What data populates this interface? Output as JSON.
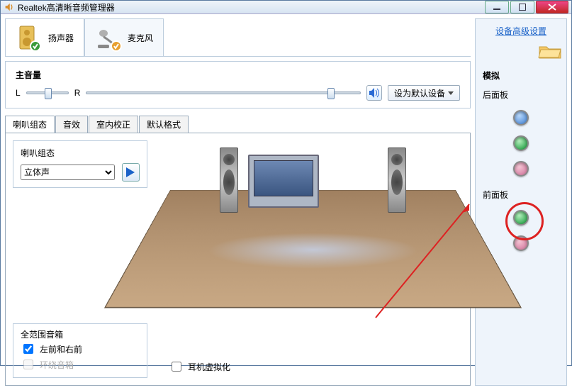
{
  "title": "Realtek高清晰音频管理器",
  "device_tabs": {
    "speaker": "扬声器",
    "mic": "麦克风"
  },
  "volume": {
    "label": "主音量",
    "left": "L",
    "right": "R"
  },
  "default_btn": "设为默认设备",
  "subtabs": {
    "config": "喇叭组态",
    "effect": "音效",
    "room": "室内校正",
    "format": "默认格式"
  },
  "config": {
    "label": "喇叭组态",
    "select": "立体声",
    "fullrange_title": "全范围音箱",
    "front_lr": "左前和右前",
    "surround": "环绕音箱",
    "headphone_virt": "耳机虚拟化"
  },
  "right": {
    "advanced": "设备高级设置",
    "section": "模拟",
    "rear": "后面板",
    "front": "前面板"
  }
}
